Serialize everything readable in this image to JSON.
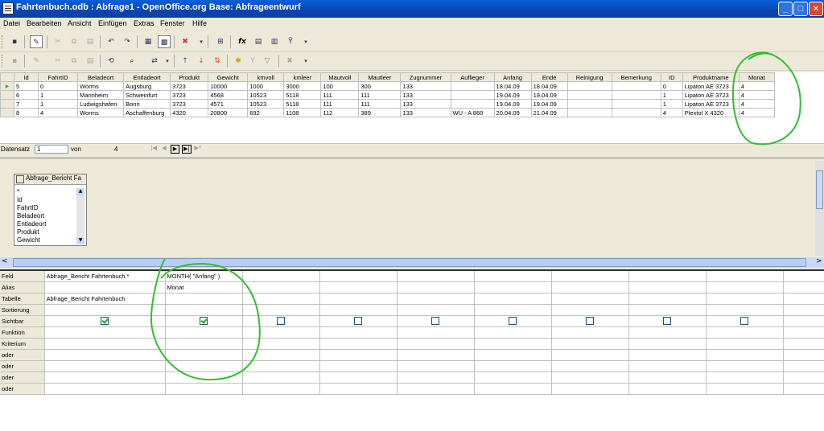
{
  "window": {
    "title": "Fahrtenbuch.odb : Abfrage1 - OpenOffice.org Base: Abfrageentwurf"
  },
  "menu": [
    "Datei",
    "Bearbeiten",
    "Ansicht",
    "Einfügen",
    "Extras",
    "Fenster",
    "Hilfe"
  ],
  "results": {
    "columns": [
      "Id",
      "FahrtID",
      "Beladeort",
      "Entladeort",
      "Produkt",
      "Gewicht",
      "kmvoll",
      "kmleer",
      "Mautvoll",
      "Mautleer",
      "Zugnummer",
      "Auflieger",
      "Anfang",
      "Ende",
      "Reinigung",
      "Bemerkung",
      "ID",
      "Produktname",
      "Monat"
    ],
    "rows": [
      [
        "5",
        "0",
        "Worms",
        "Augsburg",
        "3723",
        "10000",
        "1000",
        "3000",
        "100",
        "300",
        "133",
        "",
        "18.04.09",
        "18.04.09",
        "",
        "",
        "0",
        "Lipaton AE 3723",
        "4"
      ],
      [
        "6",
        "1",
        "Mannheim",
        "Schweinfurt",
        "3723",
        "4568",
        "10523",
        "5118",
        "111",
        "111",
        "133",
        "",
        "19.04.09",
        "19.04.09",
        "",
        "",
        "1",
        "Lipaton AE 3723",
        "4"
      ],
      [
        "7",
        "1",
        "Ludwigshafen",
        "Bonn",
        "3723",
        "4571",
        "10523",
        "5118",
        "111",
        "111",
        "133",
        "",
        "19.04.09",
        "19.04.09",
        "",
        "",
        "1",
        "Lipaton AE 3723",
        "4"
      ],
      [
        "8",
        "4",
        "Worms",
        "Aschaffenburg",
        "4320",
        "20800",
        "692",
        "1108",
        "112",
        "389",
        "133",
        "WÜ - A 860",
        "20.04.09",
        "21.04.09",
        "",
        "",
        "4",
        "Plextol X 4320",
        "4"
      ]
    ]
  },
  "nav": {
    "label": "Datensatz",
    "current": "1",
    "of_label": "von",
    "total": "4"
  },
  "table_window": {
    "title": "Abfrage_Bericht Fa",
    "fields": [
      "*",
      "Id",
      "FahrtID",
      "Beladeort",
      "Entladeort",
      "Produkt",
      "Gewicht"
    ]
  },
  "design": {
    "row_labels": [
      "Feld",
      "Alias",
      "Tabelle",
      "Sortierung",
      "Sichtbar",
      "Funktion",
      "Kriterium",
      "oder",
      "oder",
      "oder",
      "oder"
    ],
    "col1": {
      "field": "Abfrage_Bericht Fahrtenbuch.*",
      "table": "Abfrage_Bericht Fahrtenbuch"
    },
    "col2": {
      "field": "MONTH( \"Anfang\" )",
      "alias": "Monat"
    }
  },
  "annotation_color": "#2fbf2f"
}
